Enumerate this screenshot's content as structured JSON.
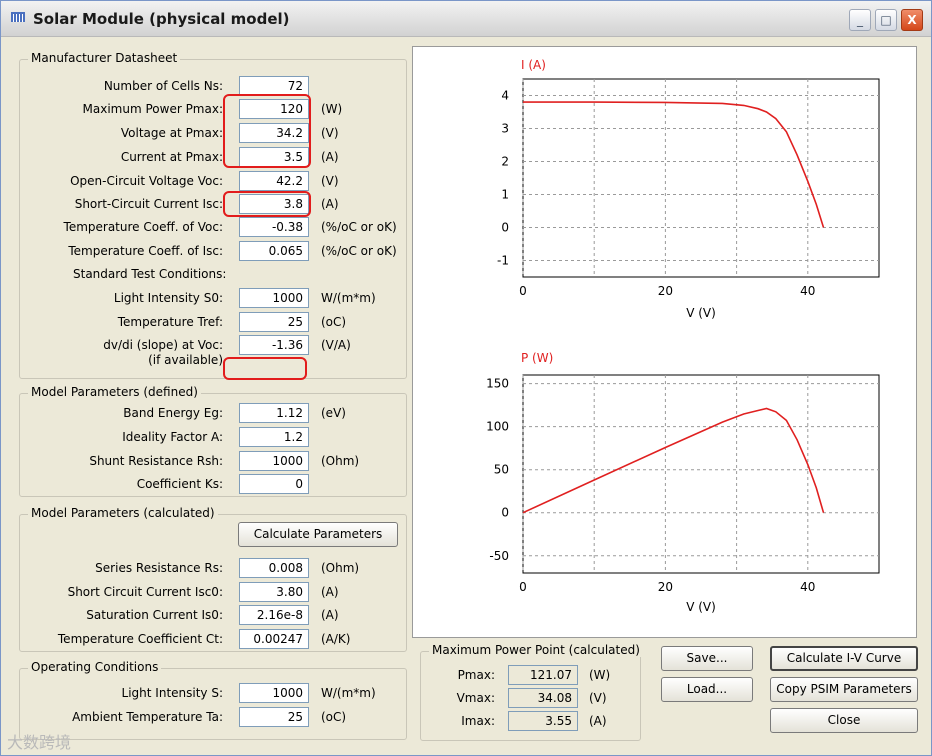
{
  "window": {
    "title": "Solar Module (physical model)",
    "controls": {
      "minimize": "_",
      "maximize": "□",
      "close": "X"
    }
  },
  "datasheet": {
    "title": "Manufacturer Datasheet",
    "rows": [
      {
        "label": "Number of Cells Ns:",
        "value": "72",
        "unit": ""
      },
      {
        "label": "Maximum Power Pmax:",
        "value": "120",
        "unit": "(W)"
      },
      {
        "label": "Voltage at Pmax:",
        "value": "34.2",
        "unit": "(V)"
      },
      {
        "label": "Current at Pmax:",
        "value": "3.5",
        "unit": "(A)"
      },
      {
        "label": "Open-Circuit Voltage Voc:",
        "value": "42.2",
        "unit": "(V)"
      },
      {
        "label": "Short-Circuit Current Isc:",
        "value": "3.8",
        "unit": "(A)"
      },
      {
        "label": "Temperature Coeff. of Voc:",
        "value": "-0.38",
        "unit": "(%/oC or oK)"
      },
      {
        "label": "Temperature Coeff. of Isc:",
        "value": "0.065",
        "unit": "(%/oC or oK)"
      }
    ],
    "stc_label": "Standard Test Conditions:",
    "stc_rows": [
      {
        "label": "Light Intensity S0:",
        "value": "1000",
        "unit": "W/(m*m)"
      },
      {
        "label": "Temperature Tref:",
        "value": "25",
        "unit": "(oC)"
      },
      {
        "label": "dv/di (slope) at Voc:",
        "value": "-1.36",
        "unit": "(V/A)"
      }
    ],
    "if_available": "(if available)"
  },
  "model_defined": {
    "title": "Model Parameters (defined)",
    "rows": [
      {
        "label": "Band Energy Eg:",
        "value": "1.12",
        "unit": "(eV)"
      },
      {
        "label": "Ideality Factor A:",
        "value": "1.2",
        "unit": ""
      },
      {
        "label": "Shunt Resistance Rsh:",
        "value": "1000",
        "unit": "(Ohm)"
      },
      {
        "label": "Coefficient Ks:",
        "value": "0",
        "unit": ""
      }
    ]
  },
  "model_calculated": {
    "title": "Model Parameters (calculated)",
    "button": "Calculate Parameters",
    "rows": [
      {
        "label": "Series Resistance Rs:",
        "value": "0.008",
        "unit": "(Ohm)"
      },
      {
        "label": "Short Circuit Current Isc0:",
        "value": "3.80",
        "unit": "(A)"
      },
      {
        "label": "Saturation Current Is0:",
        "value": "2.16e-8",
        "unit": "(A)"
      },
      {
        "label": "Temperature Coefficient Ct:",
        "value": "0.00247",
        "unit": "(A/K)"
      }
    ]
  },
  "operating": {
    "title": "Operating Conditions",
    "rows": [
      {
        "label": "Light Intensity S:",
        "value": "1000",
        "unit": "W/(m*m)"
      },
      {
        "label": "Ambient Temperature Ta:",
        "value": "25",
        "unit": "(oC)"
      }
    ]
  },
  "mpp": {
    "title": "Maximum Power Point (calculated)",
    "rows": [
      {
        "label": "Pmax:",
        "value": "121.07",
        "unit": "(W)"
      },
      {
        "label": "Vmax:",
        "value": "34.08",
        "unit": "(V)"
      },
      {
        "label": "Imax:",
        "value": "3.55",
        "unit": "(A)"
      }
    ]
  },
  "buttons": {
    "save": "Save...",
    "load": "Load...",
    "calc_iv": "Calculate I-V Curve",
    "copy_psim": "Copy PSIM Parameters",
    "close": "Close"
  },
  "watermark": "大数跨境",
  "colors": {
    "curve": "#e02020",
    "highlight": "#e21c1c",
    "axis_label": "#e02020"
  },
  "chart_data": [
    {
      "type": "line",
      "ylabel": "I (A)",
      "xlabel": "V (V)",
      "xlim": [
        0,
        50
      ],
      "ylim": [
        -1.5,
        4.5
      ],
      "xticks": [
        0,
        20,
        40
      ],
      "yticks": [
        -1,
        0,
        1,
        2,
        3,
        4
      ],
      "grid": true,
      "series": [
        {
          "x": [
            0,
            10,
            20,
            28,
            31,
            33,
            34.2,
            35.5,
            37,
            38.5,
            40,
            41.2,
            42.2
          ],
          "y": [
            3.8,
            3.8,
            3.79,
            3.76,
            3.7,
            3.6,
            3.5,
            3.3,
            2.9,
            2.2,
            1.4,
            0.7,
            0
          ]
        }
      ]
    },
    {
      "type": "line",
      "ylabel": "P (W)",
      "xlabel": "V (V)",
      "xlim": [
        0,
        50
      ],
      "ylim": [
        -70,
        160
      ],
      "xticks": [
        0,
        20,
        40
      ],
      "yticks": [
        -50,
        0,
        50,
        100,
        150
      ],
      "grid": true,
      "series": [
        {
          "x": [
            0,
            10,
            20,
            28,
            31,
            33,
            34.2,
            35.5,
            37,
            38.5,
            40,
            41.2,
            42.2
          ],
          "y": [
            0,
            38,
            75.8,
            105.3,
            114.7,
            118.8,
            121.07,
            117.2,
            107.3,
            84.7,
            56,
            28.8,
            0
          ]
        }
      ]
    }
  ]
}
